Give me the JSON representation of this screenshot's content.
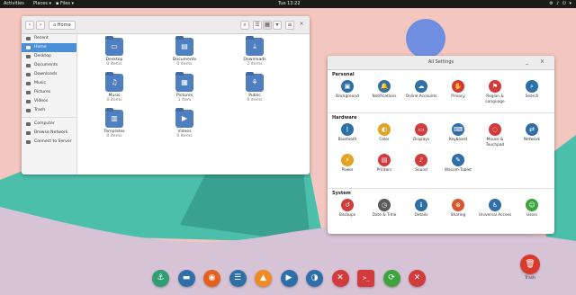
{
  "topbar": {
    "activities": "Activities",
    "places": "Places ▾",
    "files": "Files ▾",
    "clock": "Tue 13:22",
    "tray": "⚙ ♪ ⏻ ▾"
  },
  "files_window": {
    "location": "Home",
    "sidebar": [
      {
        "label": "Recent"
      },
      {
        "label": "Home"
      },
      {
        "label": "Desktop"
      },
      {
        "label": "Documents"
      },
      {
        "label": "Downloads"
      },
      {
        "label": "Music"
      },
      {
        "label": "Pictures"
      },
      {
        "label": "Videos"
      },
      {
        "label": "Trash"
      },
      {
        "label": "Computer"
      },
      {
        "label": "Browse Network"
      },
      {
        "label": "Connect to Server"
      }
    ],
    "items": [
      {
        "name": "Desktop",
        "count": "0 items",
        "glyph": "▭"
      },
      {
        "name": "Documents",
        "count": "0 items",
        "glyph": "▤"
      },
      {
        "name": "Downloads",
        "count": "2 items",
        "glyph": "⤓"
      },
      {
        "name": "Music",
        "count": "0 items",
        "glyph": "♫"
      },
      {
        "name": "Pictures",
        "count": "1 item",
        "glyph": "▦"
      },
      {
        "name": "Public",
        "count": "0 items",
        "glyph": "⚘"
      },
      {
        "name": "Templates",
        "count": "0 items",
        "glyph": "▥"
      },
      {
        "name": "Videos",
        "count": "0 items",
        "glyph": "▶"
      }
    ]
  },
  "settings_window": {
    "title": "All Settings",
    "sections": [
      {
        "title": "Personal",
        "panels": [
          {
            "label": "Background",
            "color": "#2f6fa8",
            "glyph": "▣"
          },
          {
            "label": "Notifications",
            "color": "#2f6fa8",
            "glyph": "🔔"
          },
          {
            "label": "Online Accounts",
            "color": "#2f6fa8",
            "glyph": "☁"
          },
          {
            "label": "Privacy",
            "color": "#d13b3b",
            "glyph": "✋"
          },
          {
            "label": "Region & Language",
            "color": "#d13b3b",
            "glyph": "⚑"
          },
          {
            "label": "Search",
            "color": "#2f6fa8",
            "glyph": "⌕"
          }
        ]
      },
      {
        "title": "Hardware",
        "panels": [
          {
            "label": "Bluetooth",
            "color": "#2f6fa8",
            "glyph": "ᛒ"
          },
          {
            "label": "Color",
            "color": "#e2a224",
            "glyph": "◐"
          },
          {
            "label": "Displays",
            "color": "#d13b3b",
            "glyph": "▭"
          },
          {
            "label": "Keyboard",
            "color": "#2f6fa8",
            "glyph": "⌨"
          },
          {
            "label": "Mouse & Touchpad",
            "color": "#d13b3b",
            "glyph": "◌"
          },
          {
            "label": "Network",
            "color": "#2f6fa8",
            "glyph": "⇄"
          },
          {
            "label": "Power",
            "color": "#e2a224",
            "glyph": "⚡"
          },
          {
            "label": "Printers",
            "color": "#d13b3b",
            "glyph": "▤"
          },
          {
            "label": "Sound",
            "color": "#d13b3b",
            "glyph": "♪"
          },
          {
            "label": "Wacom Tablet",
            "color": "#2f6fa8",
            "glyph": "✎"
          }
        ]
      },
      {
        "title": "System",
        "panels": [
          {
            "label": "Backups",
            "color": "#d13b3b",
            "glyph": "↺"
          },
          {
            "label": "Date & Time",
            "color": "#5a5a5a",
            "glyph": "◷"
          },
          {
            "label": "Details",
            "color": "#2f6fa8",
            "glyph": "ℹ"
          },
          {
            "label": "Sharing",
            "color": "#d6572d",
            "glyph": "⊛"
          },
          {
            "label": "Universal Access",
            "color": "#2f6fa8",
            "glyph": "♿"
          },
          {
            "label": "Users",
            "color": "#3da43d",
            "glyph": "☺"
          }
        ]
      }
    ]
  },
  "dock": [
    {
      "name": "anchor",
      "color": "#2f9e75",
      "glyph": "⚓"
    },
    {
      "name": "files",
      "color": "#2f6fa8",
      "glyph": "▬"
    },
    {
      "name": "firefox",
      "color": "#e4601e",
      "glyph": "◉"
    },
    {
      "name": "text-editor",
      "color": "#2f6fa8",
      "glyph": "☰"
    },
    {
      "name": "vlc",
      "color": "#f08a24",
      "glyph": "▲"
    },
    {
      "name": "media-player",
      "color": "#2f6fa8",
      "glyph": "▶"
    },
    {
      "name": "toggle",
      "color": "#2f6fa8",
      "glyph": "◑"
    },
    {
      "name": "tools",
      "color": "#d13b3b",
      "glyph": "✕"
    },
    {
      "name": "terminal",
      "color": "#d13b3b",
      "glyph": ">_"
    },
    {
      "name": "software-update",
      "color": "#3da43d",
      "glyph": "⟳"
    },
    {
      "name": "settings-tools",
      "color": "#d13b3b",
      "glyph": "✕"
    }
  ],
  "trash": {
    "label": "Trash",
    "glyph": "🗑"
  }
}
